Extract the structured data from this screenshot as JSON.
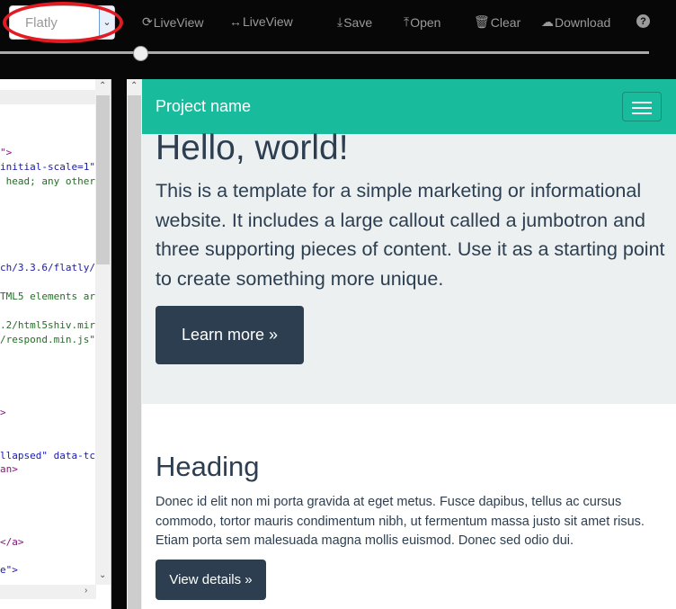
{
  "toolbar": {
    "theme": "Flatly",
    "liveview1": "LiveView",
    "liveview2": "LiveView",
    "save": "Save",
    "open": "Open",
    "clear": "Clear",
    "download": "Download",
    "slider_value_percent": 21
  },
  "editor": {
    "lines": [
      {
        "text": "\">",
        "color": "#881280"
      },
      {
        "text": "initial-scale=1\"",
        "color": "#1a1aa6"
      },
      {
        "text": " head; any other",
        "color": "#236e25"
      },
      {
        "text": "ch/3.3.6/flatly/",
        "color": "#1a1aa6"
      },
      {
        "text": "TML5 elements ar",
        "color": "#236e25"
      },
      {
        "text": ".2/html5shiv.mir",
        "color": "#236e25"
      },
      {
        "text": "/respond.min.js\"",
        "color": "#236e25"
      },
      {
        "text": ">",
        "color": "#881280"
      },
      {
        "text": "llapsed\" data-tc",
        "color": "#1a1aa6"
      },
      {
        "text": "an>",
        "color": "#881280"
      },
      {
        "text": "</a>",
        "color": "#881280"
      },
      {
        "text": "e\">",
        "color": "#1a1aa6"
      }
    ]
  },
  "preview": {
    "brand": "Project name",
    "jumbotron": {
      "title": "Hello, world!",
      "text": "This is a template for a simple marketing or informational website. It includes a large callout called a jumbotron and three supporting pieces of content. Use it as a starting point to create something more unique.",
      "button": "Learn more »"
    },
    "section": {
      "heading": "Heading",
      "body": "Donec id elit non mi porta gravida at eget metus. Fusce dapibus, tellus ac cursus commodo, tortor mauris condimentum nibh, ut fermentum massa justo sit amet risus. Etiam porta sem malesuada magna mollis euismod. Donec sed odio dui.",
      "button": "View details »"
    }
  },
  "colors": {
    "navbar": "#18bc9c",
    "primary": "#2c3e50",
    "jumbotron": "#ecf0f1",
    "highlight": "#e21b23"
  }
}
